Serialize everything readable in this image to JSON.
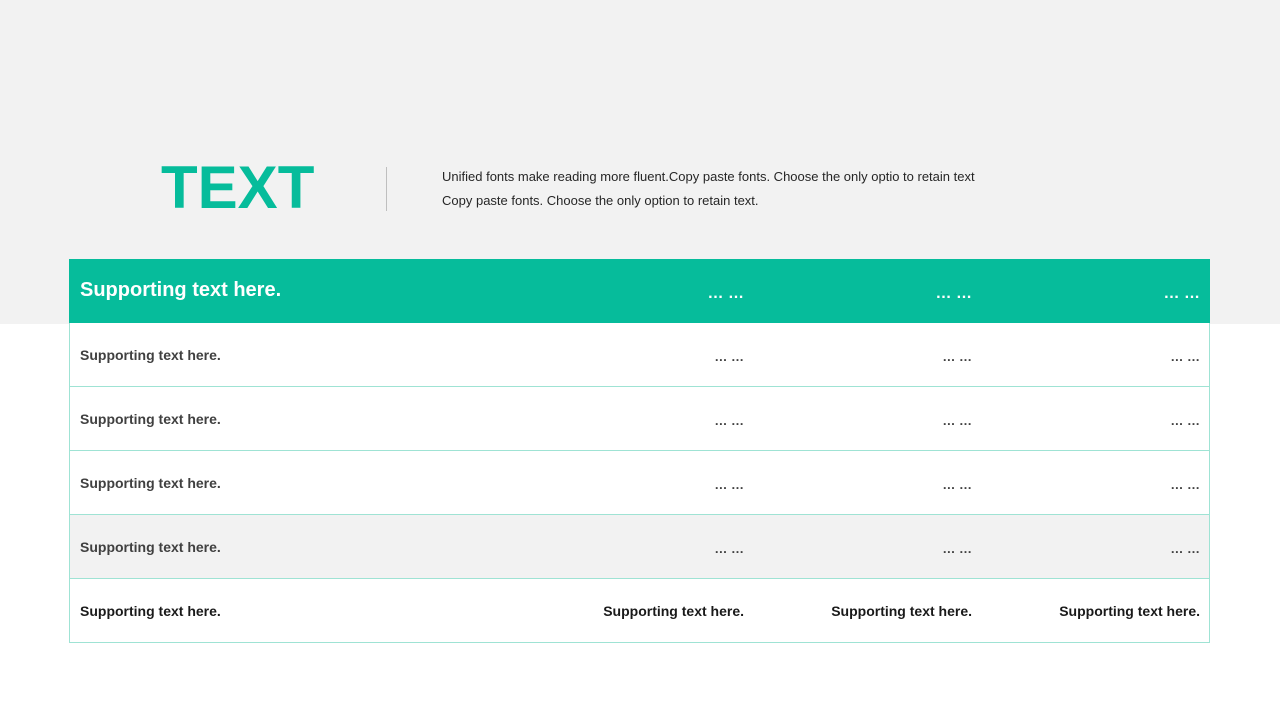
{
  "slide": {
    "headline": "TEXT",
    "description_lines": [
      "Unified fonts make reading more fluent.Copy paste fonts. Choose the only optio to retain text",
      "Copy paste  fonts. Choose the only option to retain text."
    ]
  },
  "table": {
    "header": [
      "Supporting text here.",
      "… …",
      "… …",
      "… …"
    ],
    "rows": [
      [
        "Supporting text here.",
        "… …",
        "… …",
        "… …"
      ],
      [
        "Supporting text here.",
        "… …",
        "… …",
        "… …"
      ],
      [
        "Supporting text here.",
        "… …",
        "… …",
        "… …"
      ],
      [
        "Supporting text here.",
        "… …",
        "… …",
        "… …"
      ]
    ],
    "footer": [
      "Supporting text here.",
      "Supporting text here.",
      "Supporting text here.",
      "Supporting text here."
    ]
  },
  "colors": {
    "accent": "#06bc9b",
    "band": "#f2f2f2",
    "border": "#9fe3d4"
  }
}
